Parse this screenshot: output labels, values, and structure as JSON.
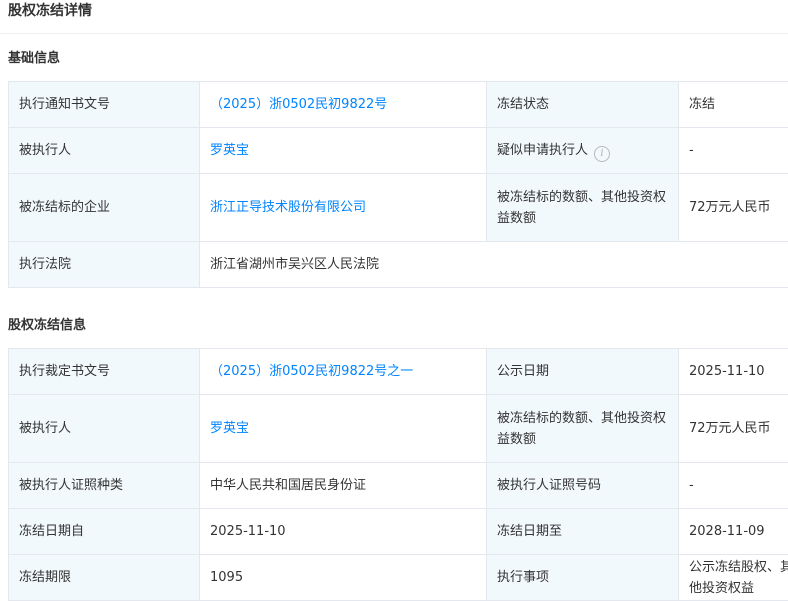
{
  "page": {
    "title": "股权冻结详情"
  },
  "basic": {
    "heading": "基础信息",
    "rows": [
      [
        {
          "label": "执行通知书文号",
          "value": "（2025）浙0502民初9822号"
        },
        {
          "label": "冻结状态",
          "value": "冻结"
        }
      ],
      [
        {
          "label": "被执行人",
          "value": "罗英宝"
        },
        {
          "label": "疑似申请执行人",
          "value": "-"
        }
      ],
      [
        {
          "label": "被冻结标的企业",
          "value": "浙江正导技术股份有限公司"
        },
        {
          "label": "被冻结标的数额、其他投资权益数额",
          "value": "72万元人民币"
        }
      ],
      [
        {
          "label": "执行法院",
          "value": "浙江省湖州市吴兴区人民法院"
        }
      ]
    ]
  },
  "freeze": {
    "heading": "股权冻结信息",
    "rows": [
      [
        {
          "label": "执行裁定书文号",
          "value": "（2025）浙0502民初9822号之一"
        },
        {
          "label": "公示日期",
          "value": "2025-11-10"
        }
      ],
      [
        {
          "label": "被执行人",
          "value": "罗英宝"
        },
        {
          "label": "被冻结标的数额、其他投资权益数额",
          "value": "72万元人民币"
        }
      ],
      [
        {
          "label": "被执行人证照种类",
          "value": "中华人民共和国居民身份证"
        },
        {
          "label": "被执行人证照号码",
          "value": "-"
        }
      ],
      [
        {
          "label": "冻结日期自",
          "value": "2025-11-10"
        },
        {
          "label": "冻结日期至",
          "value": "2028-11-09"
        }
      ],
      [
        {
          "label": "冻结期限",
          "value": "1095"
        },
        {
          "label": "执行事项",
          "value": "公示冻结股权、其他投资权益"
        }
      ]
    ]
  },
  "icons": {
    "info": "info-circle-icon"
  },
  "colors": {
    "label_bg": "#f2f9fd",
    "link": "#0084ff",
    "border": "#e4e8ee"
  }
}
